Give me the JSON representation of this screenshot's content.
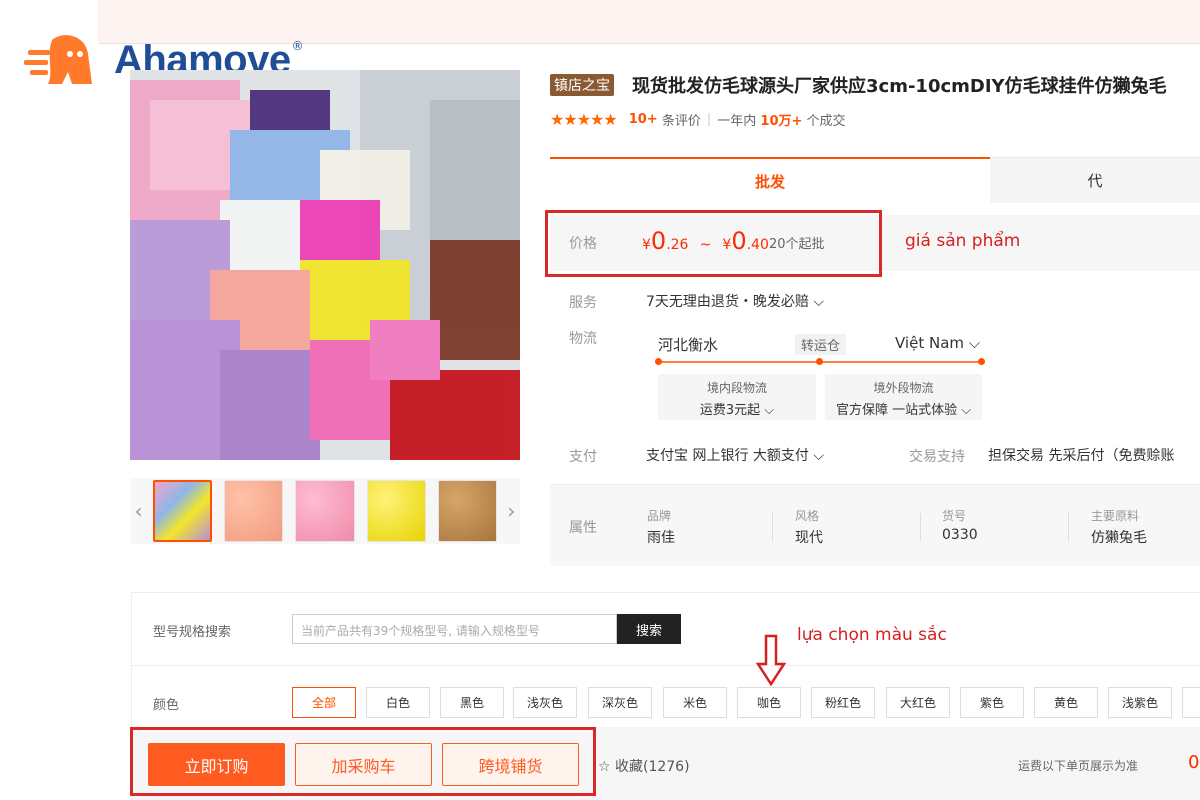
{
  "logo": {
    "text": "Ahamove",
    "reg": "®"
  },
  "product": {
    "shop_tag": "镇店之宝",
    "title": "现货批发仿毛球源头厂家供应3cm-10cmDIY仿毛球挂件仿獭兔毛",
    "stars": "★★★★★",
    "reviews_count": "10+",
    "reviews_label": "条评价",
    "year_label": "一年内",
    "sold_count": "10万+",
    "sold_label": "个成交"
  },
  "tabs": {
    "active": "批发",
    "inactive": "代"
  },
  "price": {
    "label": "价格",
    "yen": "¥",
    "low_int": "0",
    "low_dec": ".26",
    "tilde": "~",
    "high_int": "0",
    "high_dec": ".40",
    "min_batch": "20个起批",
    "annotation": "giá sản phẩm"
  },
  "service": {
    "label": "服务",
    "text": "7天无理由退货・晚发必赔 ⌵"
  },
  "logistics": {
    "label": "物流",
    "from": "河北衡水",
    "transit": "转运仓",
    "to": "Việt Nam ⌵",
    "domestic_title": "境内段物流",
    "domestic_value": "运费3元起 ⌵",
    "overseas_title": "境外段物流",
    "overseas_value": "官方保障 一站式体验 ⌵"
  },
  "payment": {
    "label": "支付",
    "methods": "支付宝   网上银行   大额支付 ⌵",
    "trade_label": "交易支持",
    "trade_items": "担保交易   先采后付（免费赊账"
  },
  "attributes": {
    "label": "属性",
    "items": [
      {
        "key": "品牌",
        "value": "雨佳"
      },
      {
        "key": "风格",
        "value": "现代"
      },
      {
        "key": "货号",
        "value": "0330"
      },
      {
        "key": "主要原料",
        "value": "仿獭兔毛"
      }
    ]
  },
  "spec_search": {
    "label": "型号规格搜索",
    "placeholder": "当前产品共有39个规格型号, 请输入规格型号",
    "button": "搜索",
    "annotation": "lựa chọn màu sắc"
  },
  "colors": {
    "label": "颜色",
    "options": [
      "全部",
      "白色",
      "黑色",
      "浅灰色",
      "深灰色",
      "米色",
      "咖色",
      "粉红色",
      "大红色",
      "紫色",
      "黄色",
      "浅紫色"
    ]
  },
  "actions": {
    "buy": "立即订购",
    "cart": "加采购车",
    "cross": "跨境铺货",
    "favorite": "☆ 收藏(1276)",
    "shipping_note": "运费以下单页展示为准",
    "shipping_value": "0"
  },
  "colors_hex": {
    "accent": "#ff5000",
    "annotation_red": "#d62020",
    "logo_orange": "#ff7a2a",
    "logo_blue": "#1f4e96"
  }
}
